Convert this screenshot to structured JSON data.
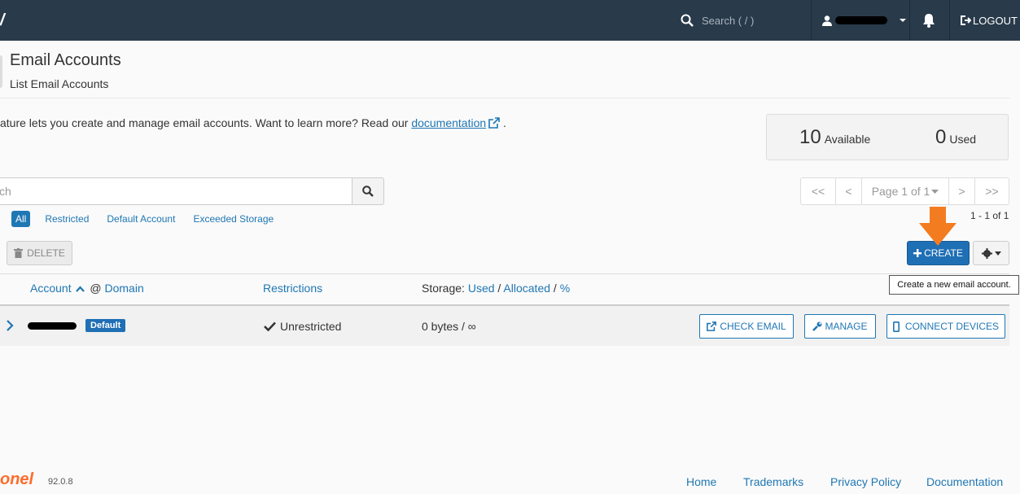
{
  "topbar": {
    "logo_fragment": "/",
    "search_placeholder": "Search ( / )",
    "logout_label": "LOGOUT"
  },
  "page": {
    "title": "Email Accounts",
    "subtitle": "List Email Accounts",
    "intro_text": "ature lets you create and manage email accounts. Want to learn more? Read our ",
    "doc_link": "documentation",
    "intro_end": " ."
  },
  "stats": {
    "available_count": "10",
    "available_label": "Available",
    "used_count": "0",
    "used_label": "Used"
  },
  "search": {
    "placeholder_fragment": "ch"
  },
  "pagination": {
    "first": "<<",
    "prev": "<",
    "page_label": "Page 1 of 1",
    "next": ">",
    "last": ">>",
    "count": "1 - 1 of 1"
  },
  "filters": [
    "All",
    "Restricted",
    "Default Account",
    "Exceeded Storage"
  ],
  "toolbar": {
    "delete_label": "DELETE",
    "create_label": "CREATE",
    "tooltip": "Create a new email account."
  },
  "table": {
    "col_account": "Account",
    "col_at": "@",
    "col_domain": "Domain",
    "col_restrictions": "Restrictions",
    "col_storage": "Storage:",
    "col_used": "Used",
    "col_allocated": "Allocated",
    "col_percent": "%",
    "row": {
      "badge": "Default",
      "restriction": "Unrestricted",
      "storage": "0 bytes / ∞",
      "check_email": "CHECK EMAIL",
      "manage": "MANAGE",
      "connect_devices": "CONNECT DEVICES"
    }
  },
  "footer": {
    "logo_fragment": "onel",
    "version": "92.0.8",
    "links": [
      "Home",
      "Trademarks",
      "Privacy Policy",
      "Documentation"
    ]
  },
  "colors": {
    "topbar": "#293a4a",
    "accent": "#1f77b4",
    "primary_button": "#1f6fb5",
    "highlight_arrow": "#f47c20"
  }
}
